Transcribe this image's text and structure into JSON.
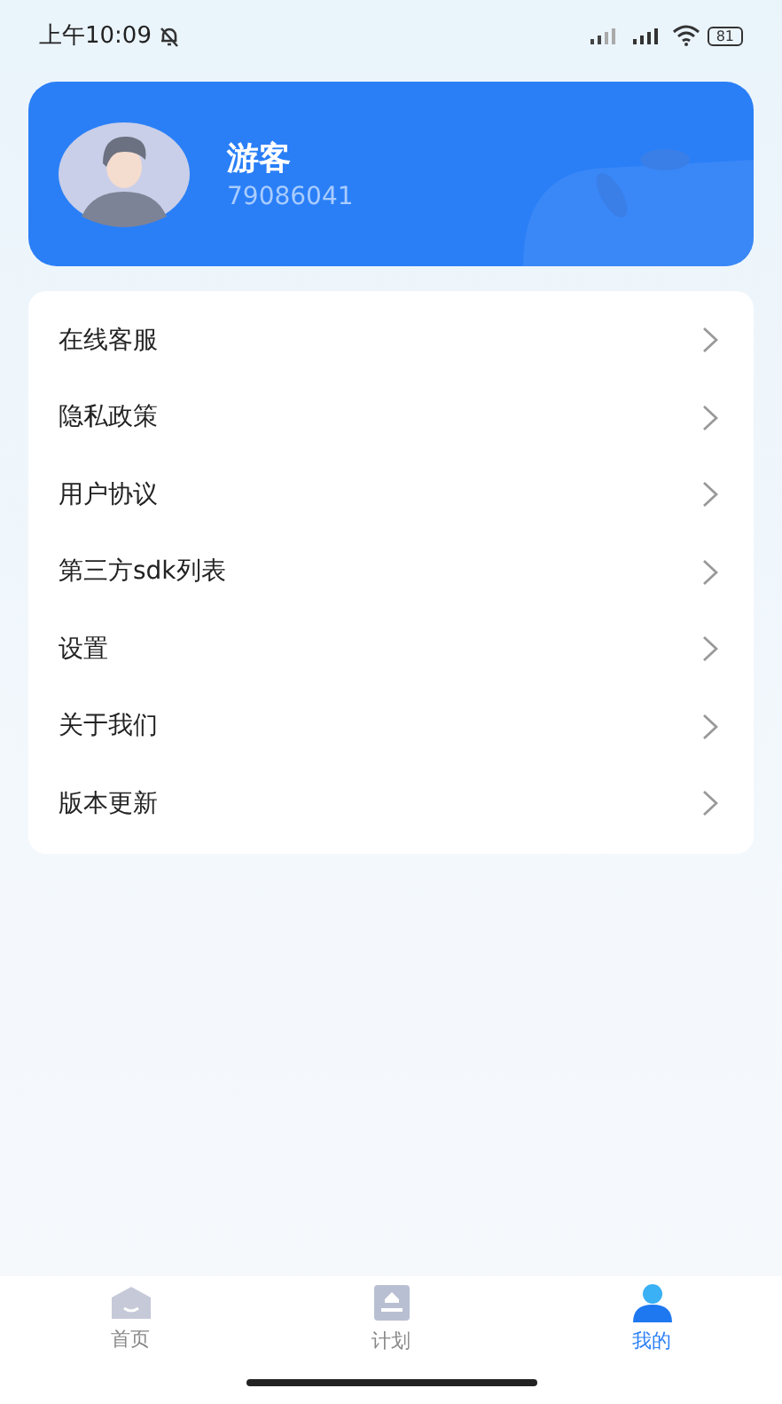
{
  "status_bar": {
    "time": "上午10:09",
    "battery": "81"
  },
  "profile": {
    "name": "游客",
    "id": "79086041"
  },
  "menu": [
    {
      "label": "在线客服"
    },
    {
      "label": "隐私政策"
    },
    {
      "label": "用户协议"
    },
    {
      "label": "第三方sdk列表"
    },
    {
      "label": "设置"
    },
    {
      "label": "关于我们"
    },
    {
      "label": "版本更新"
    }
  ],
  "tabs": [
    {
      "label": "首页",
      "kind": "home",
      "selected": false
    },
    {
      "label": "计划",
      "kind": "plan",
      "selected": false
    },
    {
      "label": "我的",
      "kind": "profile",
      "selected": true
    }
  ]
}
